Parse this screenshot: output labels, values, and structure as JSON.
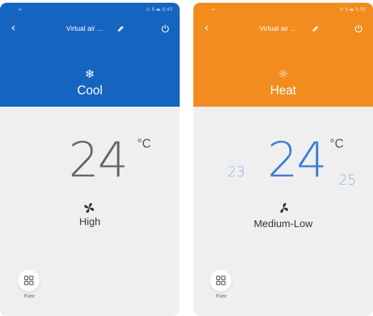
{
  "screens": [
    {
      "theme_color": "#1565c0",
      "status": {
        "left": "≈",
        "right": "⊙ 𝗅𝗅 ▬ 5:47"
      },
      "header": {
        "title": "Virtual air ..."
      },
      "mode": {
        "icon": "snowflake-icon",
        "glyph": "❄",
        "label": "Cool"
      },
      "temperature": {
        "value": "24",
        "unit": "°C"
      },
      "fan": {
        "icon": "fan-icon",
        "label": "High"
      },
      "func": {
        "label": "Func"
      }
    },
    {
      "theme_color": "#f28c1e",
      "status": {
        "left": "≈",
        "right": "⊙ 𝗅𝗅 ▬ 5:55"
      },
      "header": {
        "title": "Virtual air ..."
      },
      "mode": {
        "icon": "sun-icon",
        "glyph": "☼",
        "label": "Heat"
      },
      "temperature": {
        "value": "24",
        "unit": "°C",
        "prev": "23",
        "next": "25"
      },
      "fan": {
        "icon": "fan-icon",
        "label": "Medium-Low"
      },
      "func": {
        "label": "Func"
      }
    }
  ]
}
